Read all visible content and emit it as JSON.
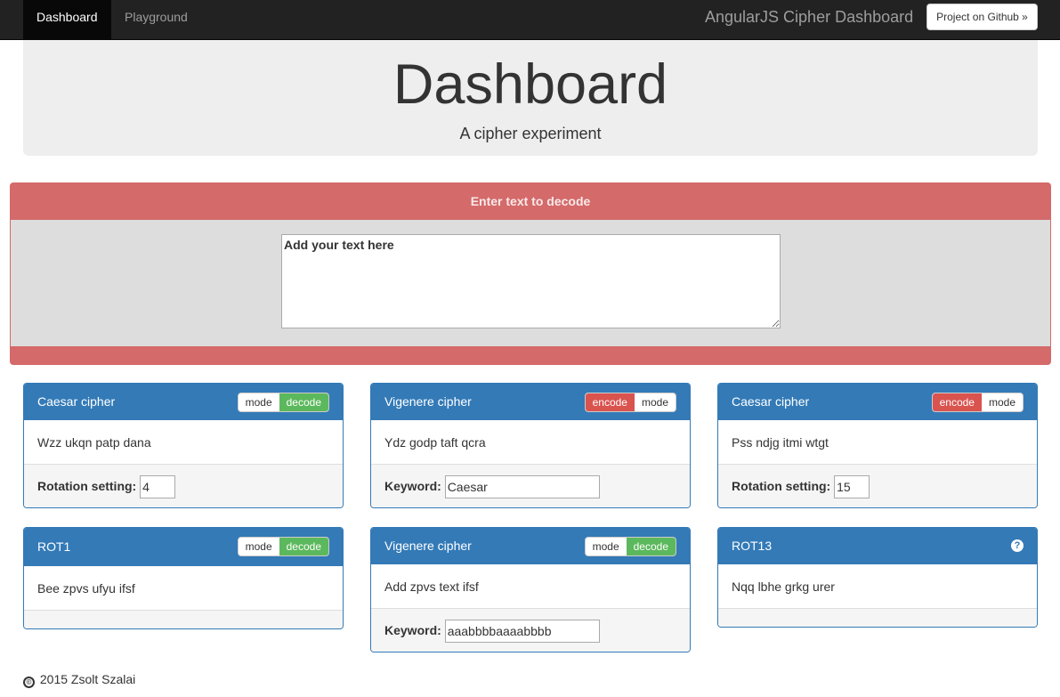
{
  "navbar": {
    "items": [
      {
        "label": "Dashboard",
        "active": true
      },
      {
        "label": "Playground",
        "active": false
      }
    ],
    "brand": "AngularJS Cipher Dashboard",
    "github_button": "Project on Github »"
  },
  "jumbotron": {
    "title": "Dashboard",
    "subtitle": "A cipher experiment"
  },
  "input_panel": {
    "heading": "Enter text to decode",
    "text_value": "Add your text here"
  },
  "panels": [
    {
      "title": "Caesar cipher",
      "toggle": [
        "mode",
        "decode"
      ],
      "output": "Wzz ukqn patp dana",
      "setting_label": "Rotation setting:",
      "setting_value": "4"
    },
    {
      "title": "Vigenere cipher",
      "toggle": [
        "encode",
        "mode"
      ],
      "output": "Ydz godp taft qcra",
      "setting_label": "Keyword:",
      "setting_value": "Caesar"
    },
    {
      "title": "Caesar cipher",
      "toggle": [
        "encode",
        "mode"
      ],
      "output": "Pss ndjg itmi wtgt",
      "setting_label": "Rotation setting:",
      "setting_value": "15"
    },
    {
      "title": "ROT1",
      "toggle": [
        "mode",
        "decode"
      ],
      "output": "Bee zpvs ufyu ifsf"
    },
    {
      "title": "Vigenere cipher",
      "toggle": [
        "mode",
        "decode"
      ],
      "output": "Add zpvs text ifsf",
      "setting_label": "Keyword:",
      "setting_value": "aaabbbbaaaabbbb"
    },
    {
      "title": "ROT13",
      "help_icon": "?",
      "output": "Nqq lbhe grkg urer"
    }
  ],
  "footer": {
    "copyright_icon": "©",
    "text": "2015 Zsolt Szalai"
  },
  "colors": {
    "navbar": "#222222",
    "panel_primary": "#337ab7",
    "input_panel": "#d46a6a",
    "decode_green": "#5cb85c",
    "encode_red": "#d9534f"
  }
}
